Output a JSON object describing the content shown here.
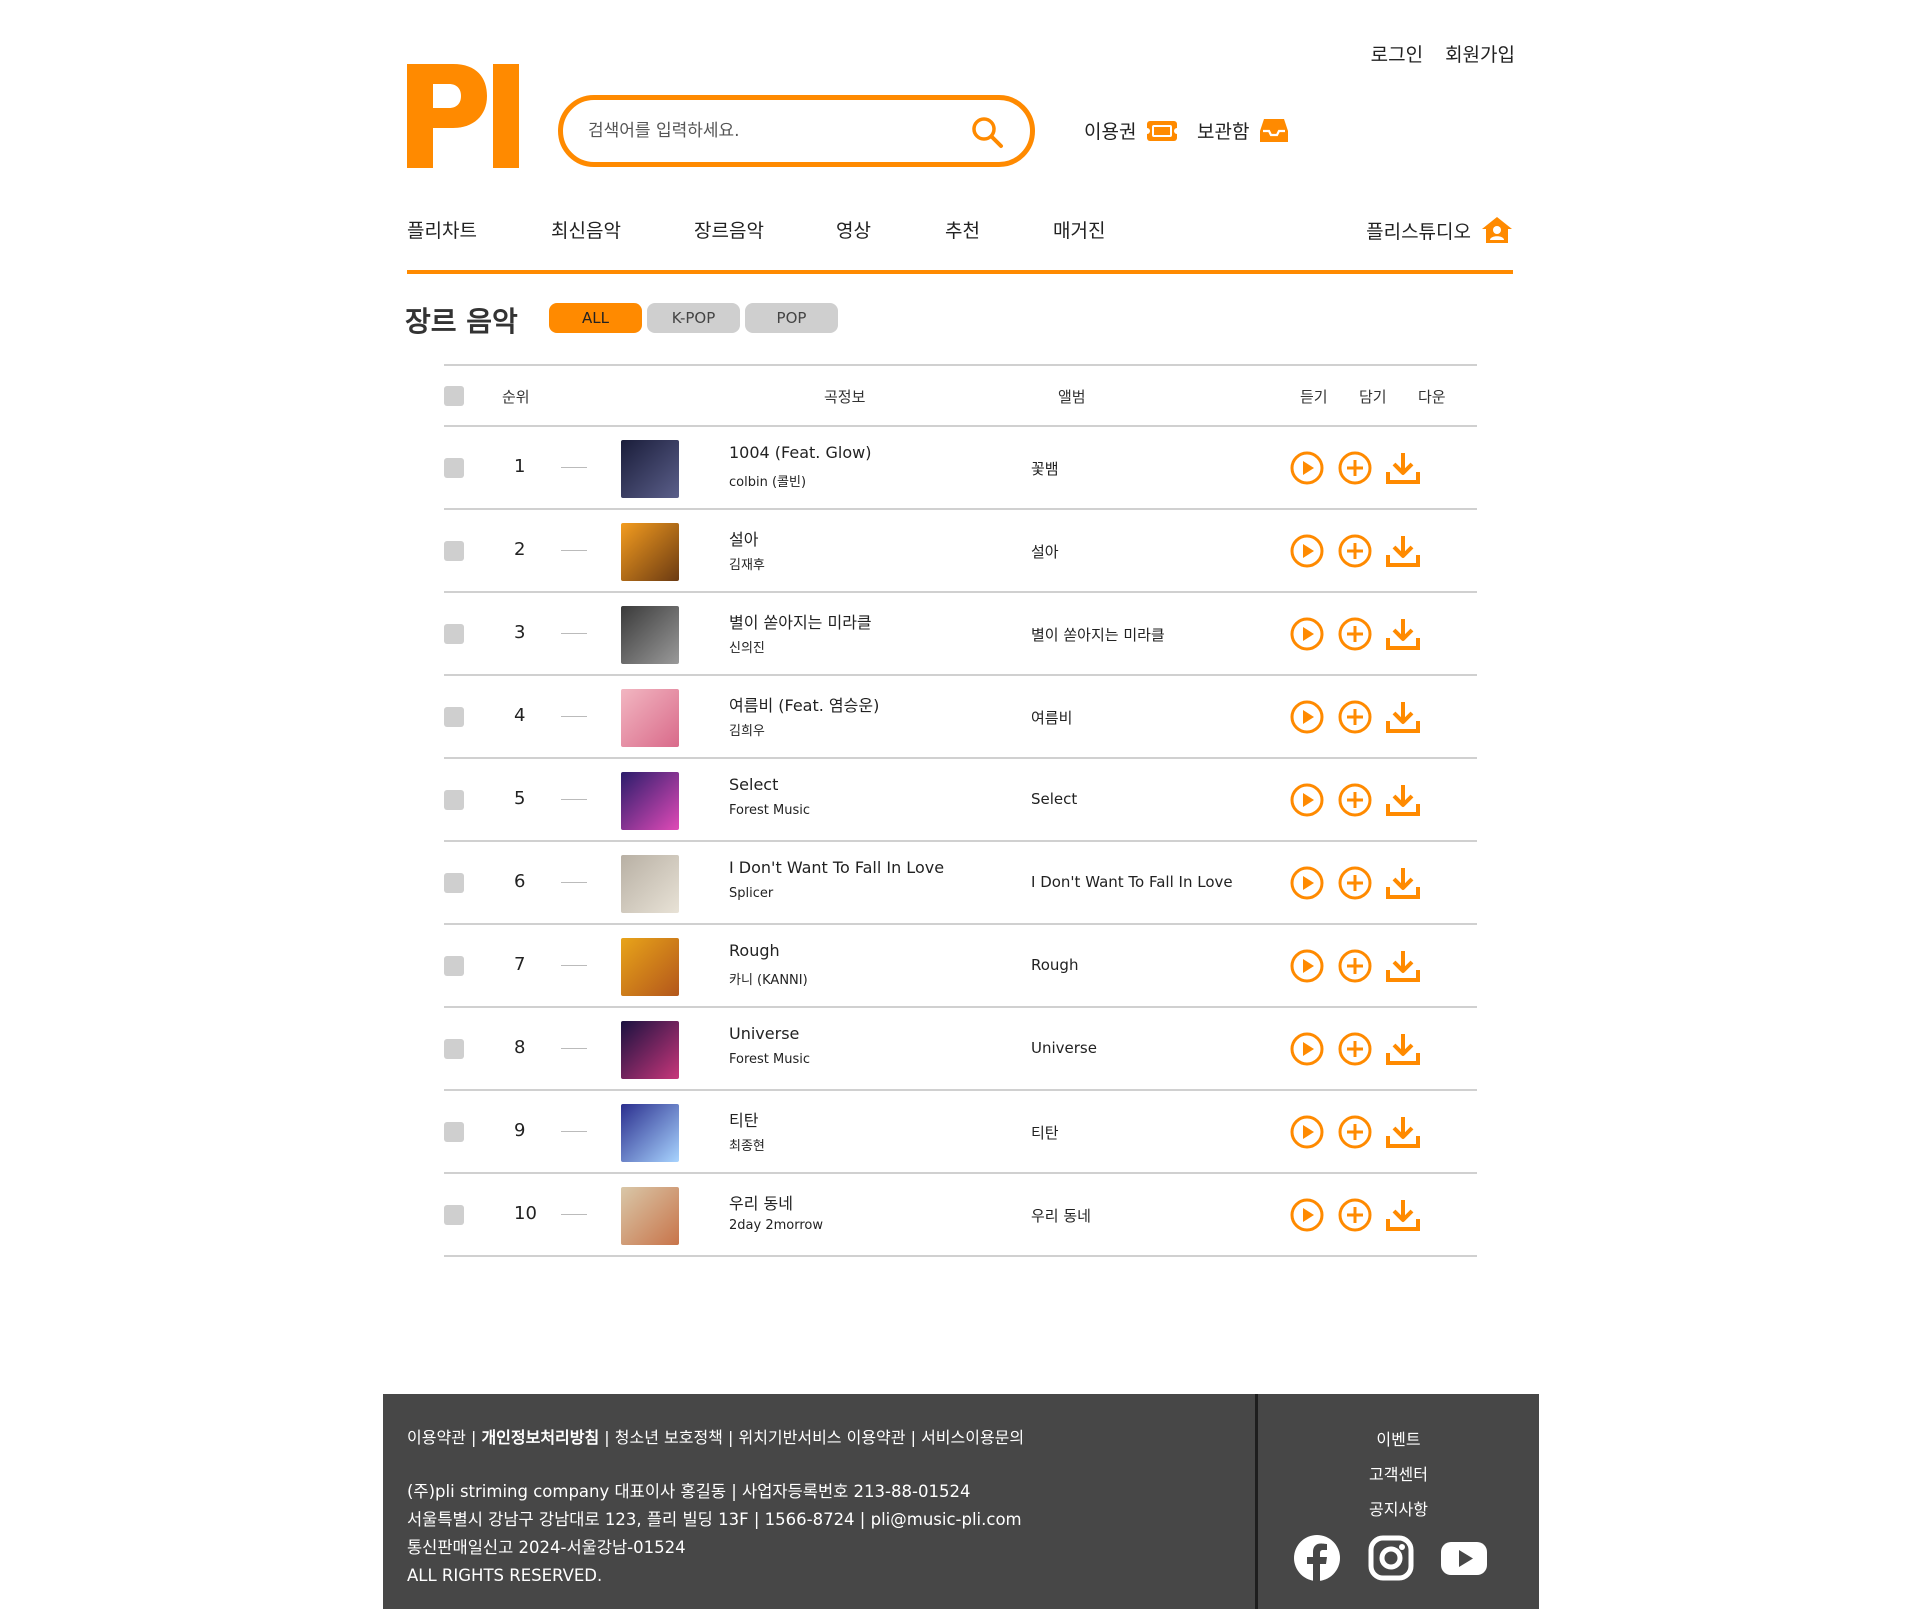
{
  "brand": {
    "logo_text": "PI",
    "accent": "#ff8a00"
  },
  "auth": {
    "login": "로그인",
    "signup": "회원가입"
  },
  "search": {
    "placeholder": "검색어를 입력하세요."
  },
  "header_links": {
    "ticket": "이용권",
    "storage": "보관함"
  },
  "nav": {
    "items": [
      "플리차트",
      "최신음악",
      "장르음악",
      "영상",
      "추천",
      "매거진"
    ],
    "studio": "플리스튜디오"
  },
  "page": {
    "title": "장르 음악",
    "filters": [
      "ALL",
      "K-POP",
      "POP"
    ],
    "active_filter": "ALL"
  },
  "table": {
    "headers": {
      "rank": "순위",
      "info": "곡정보",
      "album": "앨범",
      "listen": "듣기",
      "add": "담기",
      "download": "다운"
    },
    "rows": [
      {
        "rank": "1",
        "title": "1004 (Feat. Glow)",
        "artist": "colbin (콜빈)",
        "album": "꽃뱀",
        "cover": [
          "#1a1d3a",
          "#5b5f8a"
        ]
      },
      {
        "rank": "2",
        "title": "설아",
        "artist": "김재후",
        "album": "설아",
        "cover": [
          "#f39c1f",
          "#6b3a12"
        ]
      },
      {
        "rank": "3",
        "title": "별이 쏟아지는 미라클",
        "artist": "신의진",
        "album": "별이 쏟아지는 미라클",
        "cover": [
          "#3a3a3a",
          "#9a9a9a"
        ]
      },
      {
        "rank": "4",
        "title": "여름비 (Feat. 염승운)",
        "artist": "김희우",
        "album": "여름비",
        "cover": [
          "#f2b6c1",
          "#d96a8a"
        ]
      },
      {
        "rank": "5",
        "title": "Select",
        "artist": "Forest Music",
        "album": "Select",
        "cover": [
          "#2b1d6b",
          "#e04ab7"
        ]
      },
      {
        "rank": "6",
        "title": "I Don't Want To Fall In Love",
        "artist": "Splicer",
        "album": "I Don't Want To Fall In Love",
        "cover": [
          "#b8b0a4",
          "#e8e2d6"
        ]
      },
      {
        "rank": "7",
        "title": "Rough",
        "artist": "카니 (KANNI)",
        "album": "Rough",
        "cover": [
          "#e8a41a",
          "#b3561b"
        ]
      },
      {
        "rank": "8",
        "title": "Universe",
        "artist": "Forest Music",
        "album": "Universe",
        "cover": [
          "#1a1240",
          "#c8367a"
        ]
      },
      {
        "rank": "9",
        "title": "티탄",
        "artist": "최종현",
        "album": "티탄",
        "cover": [
          "#2b2f8e",
          "#a8d4ff"
        ]
      },
      {
        "rank": "10",
        "title": "우리 동네",
        "artist": "2day 2morrow",
        "album": "우리 동네",
        "cover": [
          "#d9c7a8",
          "#c8744a"
        ]
      }
    ]
  },
  "footer": {
    "links": [
      "이용약관",
      "개인정보처리방침",
      "청소년 보호정책",
      "위치기반서비스 이용약관",
      "서비스이용문의"
    ],
    "info": [
      "(주)pli striming company 대표이사 홍길동 | 사업자등록번호 213-88-01524",
      "서울특별시 강남구 강남대로 123, 플리 빌딩 13F | 1566-8724 | pli@music-pli.com",
      "통신판매일신고 2024-서울강남-01524",
      "ALL RIGHTS RESERVED."
    ],
    "right_links": [
      "이벤트",
      "고객센터",
      "공지사항"
    ],
    "social_icons": [
      "facebook-icon",
      "instagram-icon",
      "youtube-icon"
    ]
  }
}
